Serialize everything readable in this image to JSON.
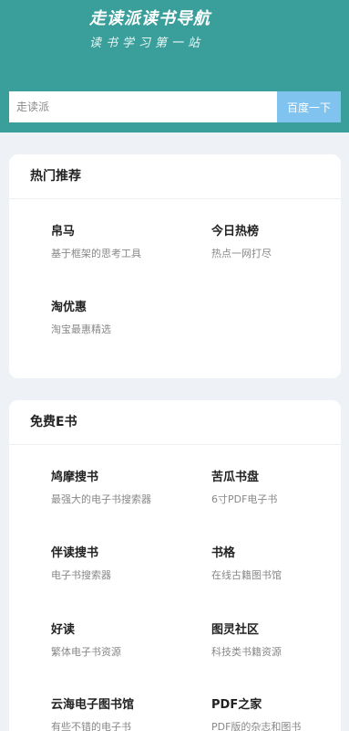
{
  "header": {
    "title": "走读派读书导航",
    "subtitle": "读书学习第一站"
  },
  "search": {
    "placeholder": "走读派",
    "button_label": "百度一下"
  },
  "sections": [
    {
      "title": "热门推荐",
      "items": [
        {
          "name": "帛马",
          "desc": "基于框架的思考工具"
        },
        {
          "name": "今日热榜",
          "desc": "热点一网打尽"
        },
        {
          "name": "淘优惠",
          "desc": "淘宝最惠精选"
        }
      ]
    },
    {
      "title": "免费E书",
      "items": [
        {
          "name": "鸠摩搜书",
          "desc": "最强大的电子书搜索器"
        },
        {
          "name": "苦瓜书盘",
          "desc": "6寸PDF电子书"
        },
        {
          "name": "伴读搜书",
          "desc": "电子书搜索器"
        },
        {
          "name": "书格",
          "desc": "在线古籍图书馆"
        },
        {
          "name": "好读",
          "desc": "繁体电子书资源"
        },
        {
          "name": "图灵社区",
          "desc": "科技类书籍资源"
        },
        {
          "name": "云海电子图书馆",
          "desc": "有些不错的电子书"
        },
        {
          "name": "PDF之家",
          "desc": "PDF版的杂志和图书"
        }
      ]
    }
  ]
}
